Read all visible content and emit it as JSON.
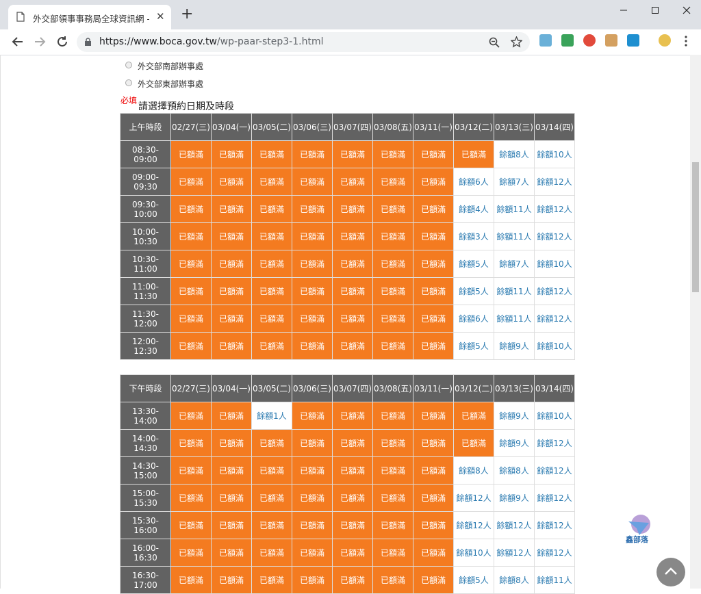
{
  "browser": {
    "tab_title": "外交部領事事務局全球資訊網 - 線",
    "close_glyph": "✕",
    "newtab_glyph": "+",
    "url_host": "https://www.boca.gov.tw",
    "url_path": "/wp-paar-step3-1.html"
  },
  "radios": [
    {
      "label": "外交部南部辦事處"
    },
    {
      "label": "外交部東部辦事處"
    }
  ],
  "required_label": "必填",
  "prompt": "請選擇預約日期及時段",
  "dates": [
    "02/27(三)",
    "03/04(一)",
    "03/05(二)",
    "03/06(三)",
    "03/07(四)",
    "03/08(五)",
    "03/11(一)",
    "03/12(二)",
    "03/13(三)",
    "03/14(四)"
  ],
  "morning": {
    "header": "上午時段",
    "rows": [
      {
        "slot": "08:30-09:00",
        "cells": [
          "已額滿",
          "已額滿",
          "已額滿",
          "已額滿",
          "已額滿",
          "已額滿",
          "已額滿",
          "已額滿",
          "餘額8人",
          "餘額10人"
        ]
      },
      {
        "slot": "09:00-09:30",
        "cells": [
          "已額滿",
          "已額滿",
          "已額滿",
          "已額滿",
          "已額滿",
          "已額滿",
          "已額滿",
          "餘額6人",
          "餘額7人",
          "餘額12人"
        ]
      },
      {
        "slot": "09:30-10:00",
        "cells": [
          "已額滿",
          "已額滿",
          "已額滿",
          "已額滿",
          "已額滿",
          "已額滿",
          "已額滿",
          "餘額4人",
          "餘額11人",
          "餘額12人"
        ]
      },
      {
        "slot": "10:00-10:30",
        "cells": [
          "已額滿",
          "已額滿",
          "已額滿",
          "已額滿",
          "已額滿",
          "已額滿",
          "已額滿",
          "餘額3人",
          "餘額11人",
          "餘額12人"
        ]
      },
      {
        "slot": "10:30-11:00",
        "cells": [
          "已額滿",
          "已額滿",
          "已額滿",
          "已額滿",
          "已額滿",
          "已額滿",
          "已額滿",
          "餘額5人",
          "餘額7人",
          "餘額10人"
        ]
      },
      {
        "slot": "11:00-11:30",
        "cells": [
          "已額滿",
          "已額滿",
          "已額滿",
          "已額滿",
          "已額滿",
          "已額滿",
          "已額滿",
          "餘額5人",
          "餘額11人",
          "餘額12人"
        ]
      },
      {
        "slot": "11:30-12:00",
        "cells": [
          "已額滿",
          "已額滿",
          "已額滿",
          "已額滿",
          "已額滿",
          "已額滿",
          "已額滿",
          "餘額6人",
          "餘額11人",
          "餘額12人"
        ]
      },
      {
        "slot": "12:00-12:30",
        "cells": [
          "已額滿",
          "已額滿",
          "已額滿",
          "已額滿",
          "已額滿",
          "已額滿",
          "已額滿",
          "餘額5人",
          "餘額9人",
          "餘額10人"
        ]
      }
    ]
  },
  "afternoon": {
    "header": "下午時段",
    "rows": [
      {
        "slot": "13:30-14:00",
        "cells": [
          "已額滿",
          "已額滿",
          "餘額1人",
          "已額滿",
          "已額滿",
          "已額滿",
          "已額滿",
          "已額滿",
          "餘額9人",
          "餘額10人"
        ]
      },
      {
        "slot": "14:00-14:30",
        "cells": [
          "已額滿",
          "已額滿",
          "已額滿",
          "已額滿",
          "已額滿",
          "已額滿",
          "已額滿",
          "已額滿",
          "餘額9人",
          "餘額12人"
        ]
      },
      {
        "slot": "14:30-15:00",
        "cells": [
          "已額滿",
          "已額滿",
          "已額滿",
          "已額滿",
          "已額滿",
          "已額滿",
          "已額滿",
          "餘額8人",
          "餘額8人",
          "餘額12人"
        ]
      },
      {
        "slot": "15:00-15:30",
        "cells": [
          "已額滿",
          "已額滿",
          "已額滿",
          "已額滿",
          "已額滿",
          "已額滿",
          "已額滿",
          "餘額12人",
          "餘額9人",
          "餘額12人"
        ]
      },
      {
        "slot": "15:30-16:00",
        "cells": [
          "已額滿",
          "已額滿",
          "已額滿",
          "已額滿",
          "已額滿",
          "已額滿",
          "已額滿",
          "餘額12人",
          "餘額12人",
          "餘額12人"
        ]
      },
      {
        "slot": "16:00-16:30",
        "cells": [
          "已額滿",
          "已額滿",
          "已額滿",
          "已額滿",
          "已額滿",
          "已額滿",
          "已額滿",
          "餘額10人",
          "餘額12人",
          "餘額12人"
        ]
      },
      {
        "slot": "16:30-17:00",
        "cells": [
          "已額滿",
          "已額滿",
          "已額滿",
          "已額滿",
          "已額滿",
          "已額滿",
          "已額滿",
          "餘額5人",
          "餘額8人",
          "餘額11人"
        ]
      }
    ]
  },
  "full_text": "已額滿",
  "colors": {
    "full": "#f47b20",
    "open_text": "#2a7ab0",
    "header": "#626262",
    "required": "#ee0000"
  },
  "logo_text": "鑫部落"
}
